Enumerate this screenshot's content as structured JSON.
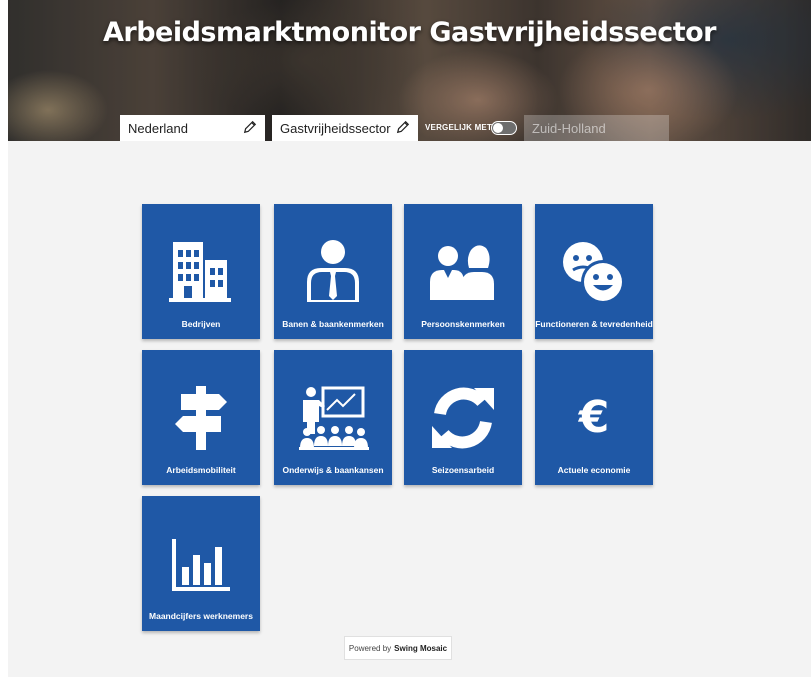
{
  "header": {
    "title": "Arbeidsmarktmonitor Gastvrijheidssector",
    "region": "Nederland",
    "sector": "Gastvrijheidssector",
    "compare_label": "VERGELIJK MET",
    "compare_enabled": false,
    "compare_region": "Zuid-Holland"
  },
  "tiles": [
    {
      "label": "Bedrijven",
      "icon": "buildings-icon"
    },
    {
      "label": "Banen & baankenmerken",
      "icon": "person-tie-icon"
    },
    {
      "label": "Persoonskenmerken",
      "icon": "people-icon"
    },
    {
      "label": "Functioneren & tevredenheid",
      "icon": "smileys-icon"
    },
    {
      "label": "Arbeidsmobiliteit",
      "icon": "signpost-icon"
    },
    {
      "label": "Onderwijs & baankansen",
      "icon": "classroom-icon"
    },
    {
      "label": "Seizoensarbeid",
      "icon": "refresh-icon"
    },
    {
      "label": "Actuele economie",
      "icon": "euro-icon"
    },
    {
      "label": "Maandcijfers werknemers",
      "icon": "bar-chart-icon"
    }
  ],
  "footer": {
    "powered_by": "Powered by",
    "brand": "Swing Mosaic"
  },
  "colors": {
    "tile": "#1f58a6",
    "background": "#f3f3f3"
  }
}
